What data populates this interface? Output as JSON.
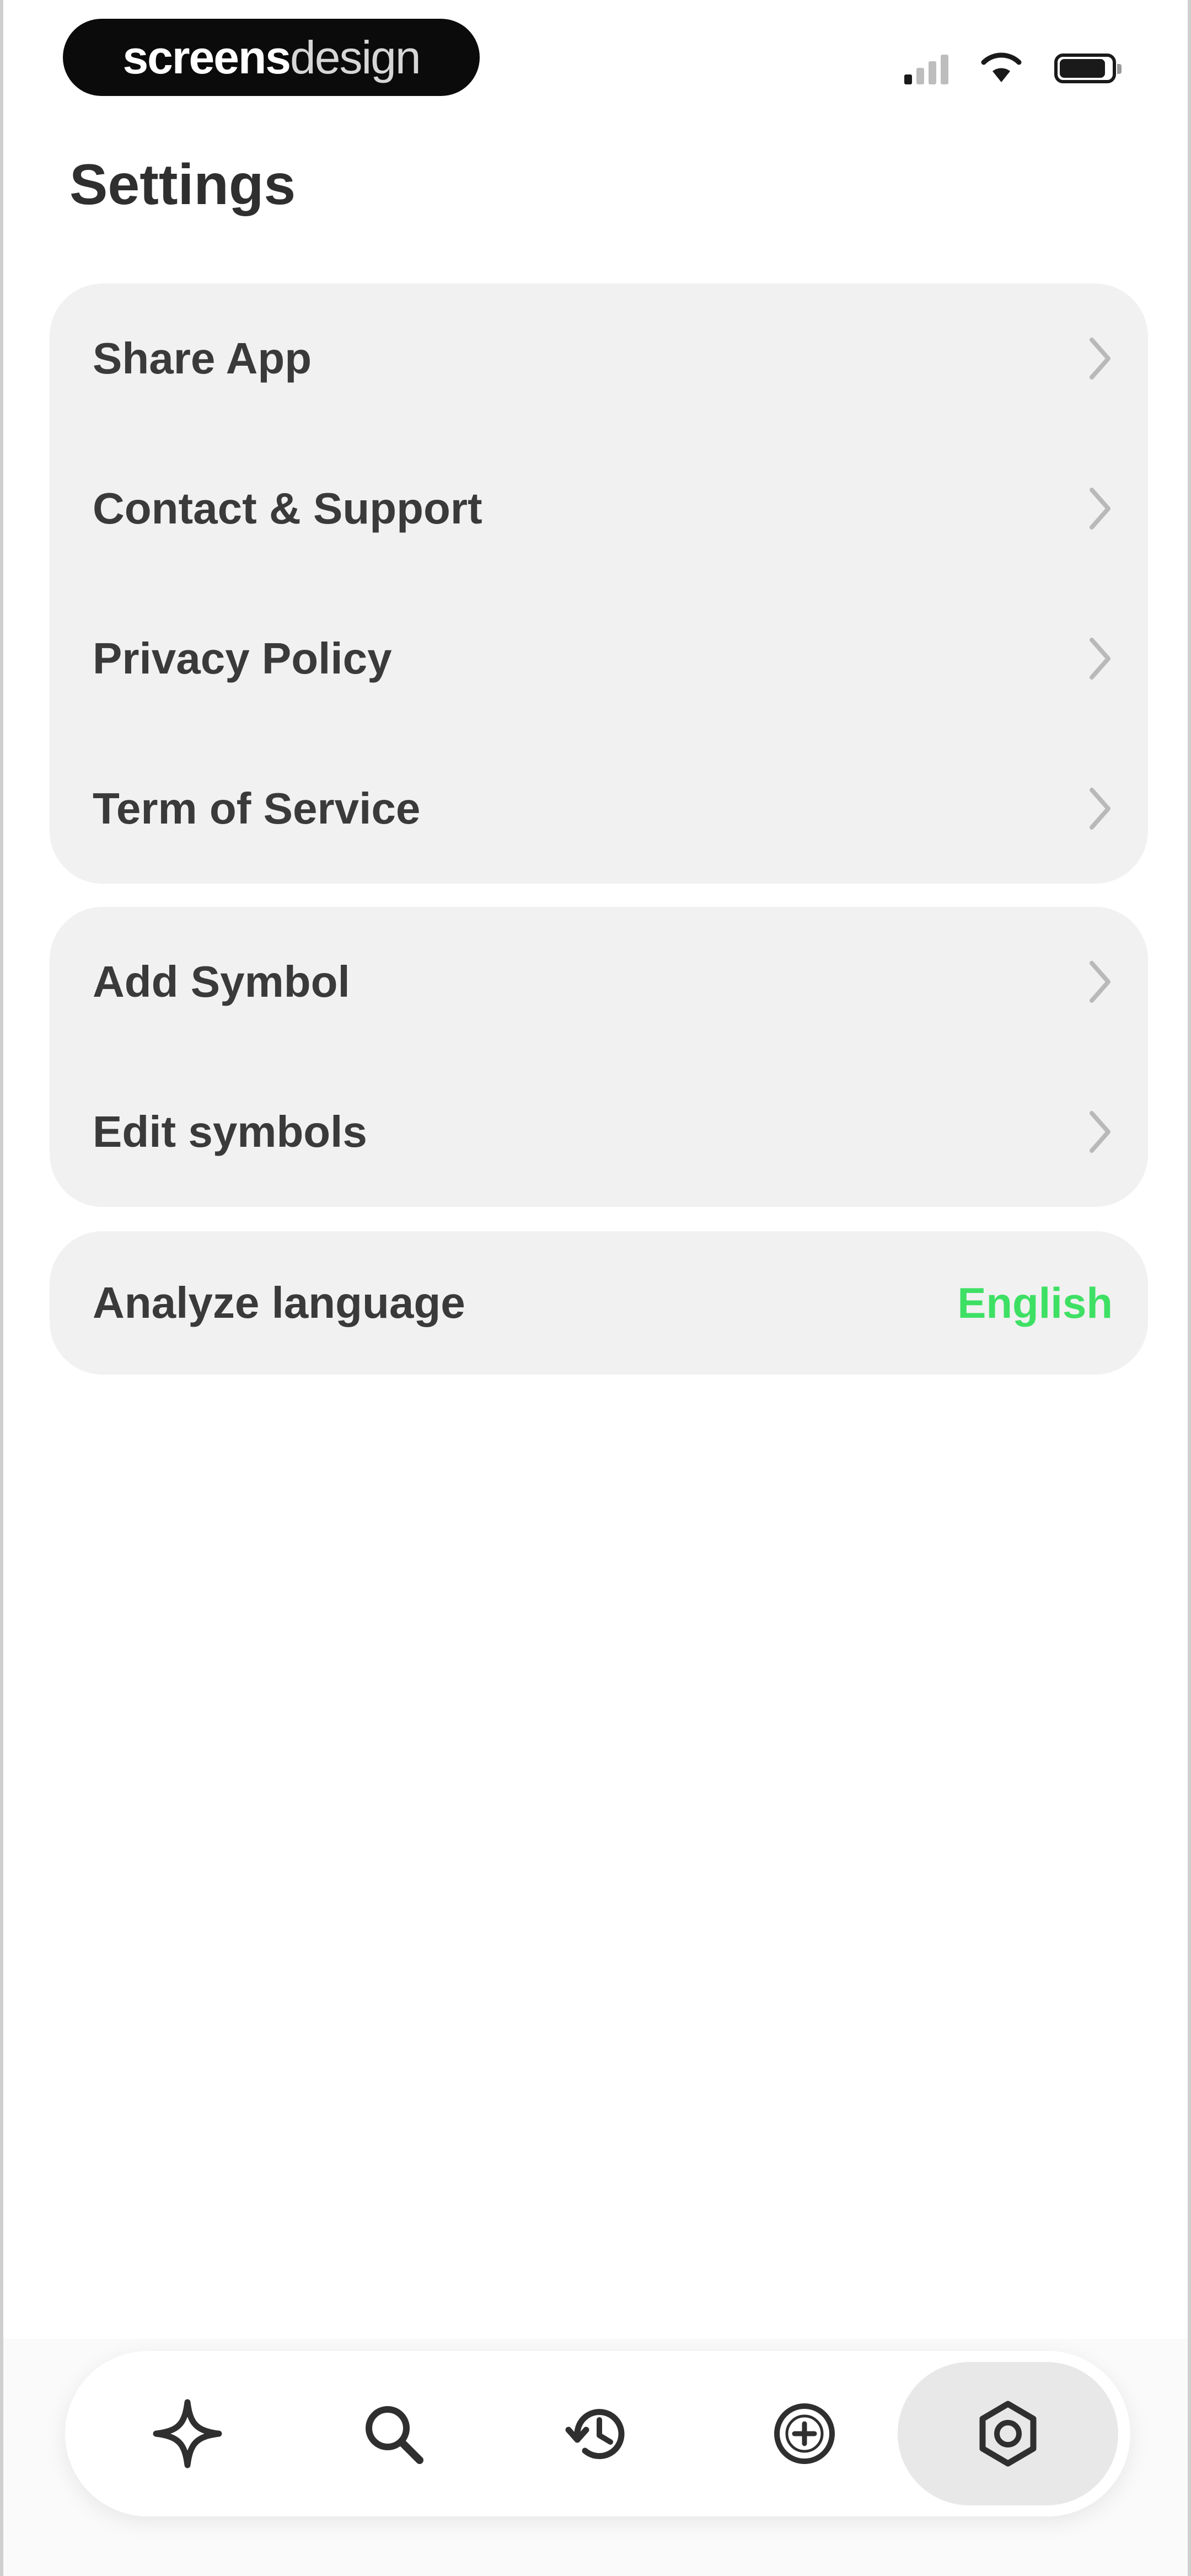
{
  "status_bar": {
    "brand": {
      "part1": "screens",
      "part2": "design"
    },
    "signal_icon": "cellular-signal-icon",
    "wifi_icon": "wifi-icon",
    "battery_icon": "battery-icon"
  },
  "page": {
    "title": "Settings"
  },
  "groups": [
    {
      "items": [
        {
          "label": "Share App",
          "icon": "chevron-right-icon"
        },
        {
          "label": "Contact & Support",
          "icon": "chevron-right-icon"
        },
        {
          "label": "Privacy Policy",
          "icon": "chevron-right-icon"
        },
        {
          "label": "Term of Service",
          "icon": "chevron-right-icon"
        }
      ]
    },
    {
      "items": [
        {
          "label": "Add Symbol",
          "icon": "chevron-right-icon"
        },
        {
          "label": "Edit symbols",
          "icon": "chevron-right-icon"
        }
      ]
    },
    {
      "items": [
        {
          "label": "Analyze language",
          "value": "English"
        }
      ]
    }
  ],
  "tabbar": {
    "items": [
      {
        "name": "sparkle-icon",
        "active": false
      },
      {
        "name": "search-icon",
        "active": false
      },
      {
        "name": "history-icon",
        "active": false
      },
      {
        "name": "add-circle-icon",
        "active": false
      },
      {
        "name": "settings-gear-icon",
        "active": true
      }
    ]
  },
  "colors": {
    "accent": "#3ee064",
    "card": "#f1f1f1",
    "active_tab": "#e8e8e8"
  }
}
